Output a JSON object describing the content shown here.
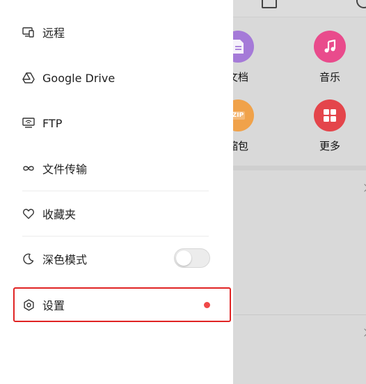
{
  "background": {
    "grid": [
      {
        "id": "docs",
        "label": "文档",
        "color": "#a57ad8",
        "icon": "document-icon"
      },
      {
        "id": "music",
        "label": "音乐",
        "color": "#e94b8c",
        "icon": "music-note-icon"
      },
      {
        "id": "archive",
        "label": "缩包",
        "badge": "ZIP",
        "color": "#f0a24a",
        "icon": "zip-icon"
      },
      {
        "id": "more",
        "label": "更多",
        "color": "#e4454b",
        "icon": "grid-icon"
      }
    ]
  },
  "drawer": {
    "items": [
      {
        "id": "remote",
        "label": "远程",
        "icon": "remote-device-icon"
      },
      {
        "id": "gdrive",
        "label": "Google Drive",
        "icon": "google-drive-icon"
      },
      {
        "id": "ftp",
        "label": "FTP",
        "icon": "ftp-icon"
      },
      {
        "id": "transfer",
        "label": "文件传输",
        "icon": "infinity-icon"
      },
      {
        "id": "favorites",
        "label": "收藏夹",
        "icon": "heart-icon"
      },
      {
        "id": "darkmode",
        "label": "深色模式",
        "icon": "moon-icon",
        "toggle_on": false
      },
      {
        "id": "settings",
        "label": "设置",
        "icon": "gear-icon",
        "has_notification": true
      }
    ]
  },
  "colors": {
    "highlight": "#e02424",
    "notification_dot": "#f04848"
  }
}
